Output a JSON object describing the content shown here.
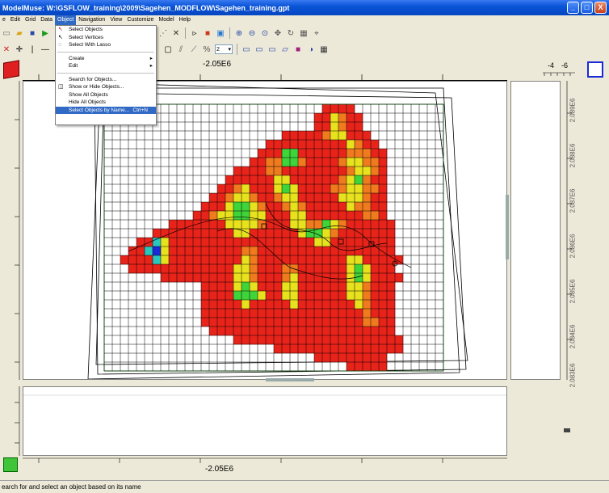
{
  "window": {
    "title": "ModelMuse: W:\\GSFLOW_training\\2009\\Sagehen_MODFLOW\\Sagehen_training.gpt",
    "min_label": "_",
    "max_label": "□",
    "close_label": "X"
  },
  "menu": [
    "e",
    "Edit",
    "Grid",
    "Data",
    "Object",
    "Navigation",
    "View",
    "Customize",
    "Model",
    "Help"
  ],
  "object_menu": {
    "items": [
      {
        "label": "Select Objects",
        "icon": "↖"
      },
      {
        "label": "Select Vertices",
        "icon": "↖"
      },
      {
        "label": "Select With Lasso",
        "icon": "◌"
      },
      {
        "label": "Create",
        "submenu": "▸"
      },
      {
        "label": "Edit",
        "submenu": "▸"
      },
      {
        "label": "Search for Objects..."
      },
      {
        "label": "Show or Hide Objects...",
        "icon": "◫"
      },
      {
        "label": "Show All Objects"
      },
      {
        "label": "Hide All Objects"
      },
      {
        "label": "Select Objects by Name...",
        "shortcut": "Ctrl+N"
      }
    ]
  },
  "toolbar": {
    "layer_combo": "2"
  },
  "rulers": {
    "top_label": "-2.05E6",
    "top_right_labels": [
      "-4",
      "-6"
    ],
    "bottom_label": "-2.05E6",
    "right_labels": [
      "2.089E6",
      "2.088E6",
      "2.087E6",
      "2.086E6",
      "2.085E6",
      "2.084E6",
      "2.083E6"
    ]
  },
  "status": {
    "text": "earch for and select an object based on its name"
  },
  "colors": {
    "red": "#e8231a",
    "orange": "#f07a1e",
    "yellow": "#e8e21e",
    "green": "#3fd43a",
    "cyan": "#27c7c0",
    "blue": "#1a2ad8",
    "menu_highlight": "#316ac5",
    "titlebar": "#0a55d8"
  },
  "grid_map": [
    "...........................RRRR...........",
    "..........................RRYORR..........",
    "..........................RRYORR..........",
    "......................RRRRROYYRRR.........",
    "....................RRRRRRRRRRYORR........",
    "...................RRRGGRRRRRROOORR.......",
    "..................RROOGGORRRROYYOOR.......",
    "................RRRROORRRRRRRROYYOR.......",
    "...............RRRRRRYYRRRRRROYGORR.......",
    "..............RROYRRRYGYRRRROOYYOOR.......",
    ".............RROYYORROYYRRRRRYYYORR.......",
    "............RRRYGGYORROYORRRRRYOORR.......",
    "...........RROYYGGYYRRRYYRRRRRRROOR.......",
    "........RRRRRRRYYYYORRRYYOOGYORRRRRR......",
    "......RRRRRRRRRRYYRRRRRRYGGYORRRRRRR......",
    "....RRCYRRRRRRRRRRRRRRRRRRYYRRRRRRRR......",
    "...RRCBYRRRRRRRRROORRRRRRRRRRRRRRRRR......",
    "..RRRRCYRRRRRRRRRYORRRRRRRRRRRYYRRRRR.....",
    "...RRRRRRRRRRRRRYYORRROORRRRRRYGYRRR......",
    ".......RRRRRRRRRYYORRROYRRRRRRYGYRRRR.....",
    "............RRRRYGYRRRYYRRRRRRYYORRR......",
    "............RRRRGGGYRRYYRRRRRRYYORRR......",
    "............RRRRRYRRRRRYRRRRRRRYORRR......",
    "............RRRRRRRRRRRRRRRRRRRRORRR......",
    "............RRRRRRRRRRRRRRRRRRRROORR......",
    ".............RRRRRRRRRRRRRRRRRRRRRRR......",
    "................RRRRRRRRRRRRRRRRRRRRR.....",
    ".....................RRRRRRRRRRRRRRRR.....",
    "..........................RRRRRRRRR.......",
    "..............................RRRRR......."
  ]
}
